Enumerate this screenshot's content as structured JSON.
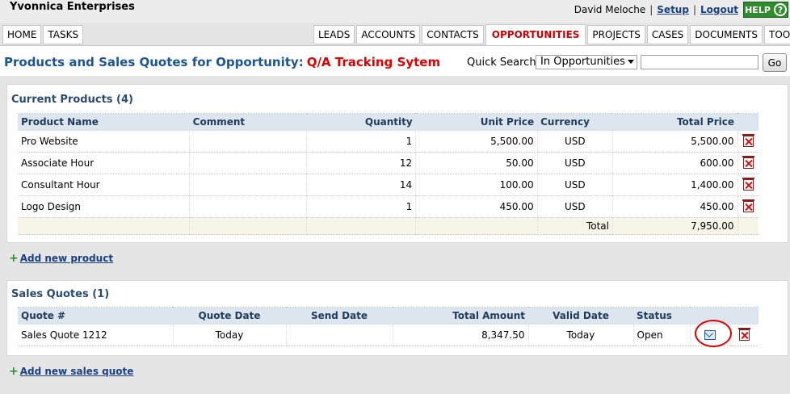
{
  "header": {
    "company": "Yvonnica Enterprises",
    "user_name": "David Meloche",
    "setup_label": "Setup",
    "logout_label": "Logout",
    "help_label": "HELP",
    "help_glyph": "?"
  },
  "tabs_left": [
    "HOME",
    "TASKS"
  ],
  "tabs_right": [
    "LEADS",
    "ACCOUNTS",
    "CONTACTS",
    "OPPORTUNITIES",
    "PROJECTS",
    "CASES",
    "DOCUMENTS",
    "TOOLS"
  ],
  "active_tab": "OPPORTUNITIES",
  "page": {
    "title_prefix": "Products and Sales Quotes for Opportunity:",
    "opportunity_name": "Q/A Tracking Sytem"
  },
  "quick_search": {
    "label": "Quick Search",
    "scope": "In Opportunities",
    "value": "",
    "go_label": "Go"
  },
  "products": {
    "title": "Current Products (4)",
    "columns": [
      "Product Name",
      "Comment",
      "Quantity",
      "Unit Price",
      "Currency",
      "Total Price"
    ],
    "rows": [
      {
        "name": "Pro Website",
        "comment": "",
        "quantity": "1",
        "unit_price": "5,500.00",
        "currency": "USD",
        "total": "5,500.00"
      },
      {
        "name": "Associate Hour",
        "comment": "",
        "quantity": "12",
        "unit_price": "50.00",
        "currency": "USD",
        "total": "600.00"
      },
      {
        "name": "Consultant Hour",
        "comment": "",
        "quantity": "14",
        "unit_price": "100.00",
        "currency": "USD",
        "total": "1,400.00"
      },
      {
        "name": "Logo Design",
        "comment": "",
        "quantity": "1",
        "unit_price": "450.00",
        "currency": "USD",
        "total": "450.00"
      }
    ],
    "total_label": "Total",
    "total_value": "7,950.00",
    "add_label": "Add new product"
  },
  "quotes": {
    "title": "Sales Quotes (1)",
    "columns": [
      "Quote #",
      "Quote Date",
      "Send Date",
      "Total Amount",
      "Valid Date",
      "Status"
    ],
    "rows": [
      {
        "quote": "Sales Quote 1212",
        "quote_date": "Today",
        "send_date": "",
        "total_amount": "8,347.50",
        "valid_date": "Today",
        "status": "Open"
      }
    ],
    "add_label": "Add new sales quote"
  },
  "colors": {
    "accent_blue": "#1b5595",
    "opportunity_red": "#e00000",
    "help_green": "#2e8b2e",
    "header_row": "#dde6ef"
  }
}
